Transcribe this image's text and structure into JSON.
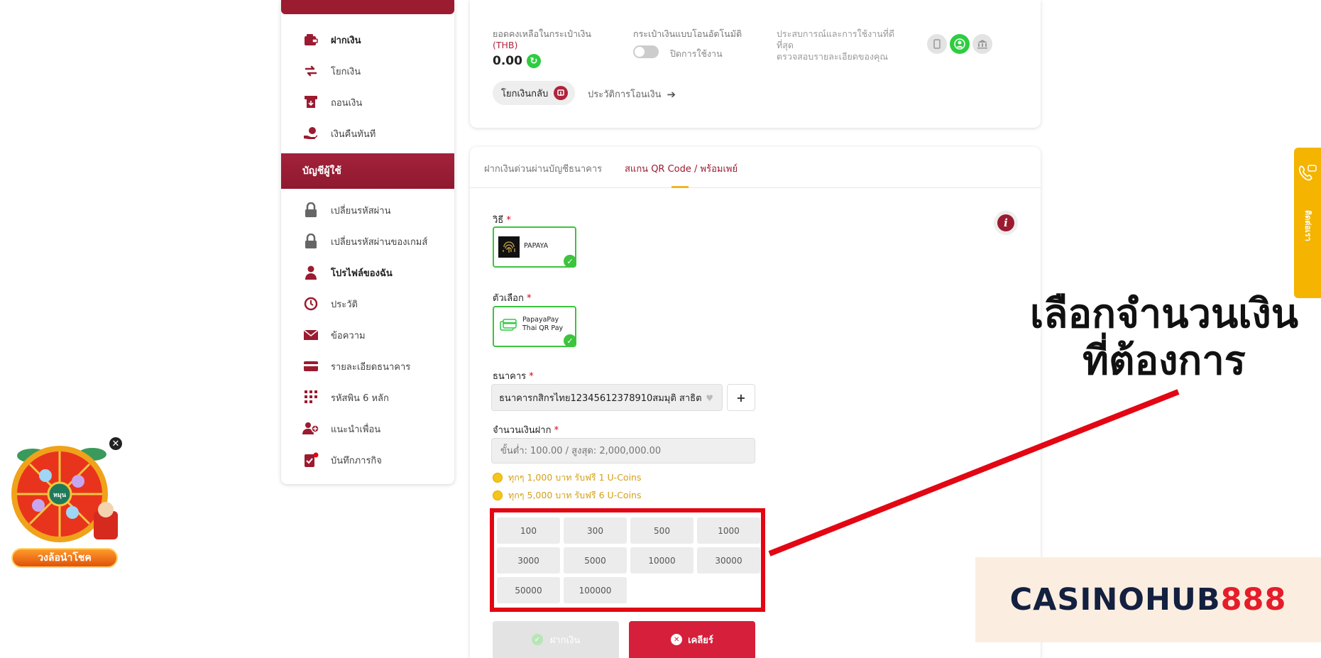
{
  "sidebar": {
    "items_top": [
      {
        "label": "ฝากเงิน",
        "icon": "wallet-icon",
        "bold": true
      },
      {
        "label": "โยกเงิน",
        "icon": "transfer-arrows-icon",
        "bold": false
      },
      {
        "label": "ถอนเงิน",
        "icon": "withdraw-icon",
        "bold": false
      },
      {
        "label": "เงินคืนทันที",
        "icon": "cashback-hand-icon",
        "bold": false
      }
    ],
    "section_title": "บัญชีผู้ใช้",
    "items_account": [
      {
        "label": "เปลี่ยนรหัสผ่าน",
        "icon": "lock-icon",
        "bold": false
      },
      {
        "label": "เปลี่ยนรหัสผ่านของเกมส์",
        "icon": "lock-icon",
        "bold": false
      },
      {
        "label": "โปรไฟล์ของฉัน",
        "icon": "user-icon",
        "bold": true
      },
      {
        "label": "ประวัติ",
        "icon": "history-clock-icon",
        "bold": false
      },
      {
        "label": "ข้อความ",
        "icon": "mail-icon",
        "bold": false
      },
      {
        "label": "รายละเอียดธนาคาร",
        "icon": "bank-card-icon",
        "bold": false
      },
      {
        "label": "รหัสพิน 6 หลัก",
        "icon": "pin-keypad-icon",
        "bold": false
      },
      {
        "label": "แนะนำเพื่อน",
        "icon": "refer-friends-icon",
        "bold": false
      },
      {
        "label": "บันทึกภารกิจ",
        "icon": "mission-log-icon",
        "bold": false
      }
    ]
  },
  "wallet": {
    "balance_label": "ยอดคงเหลือในกระเป๋าเงิน",
    "currency": "(THB)",
    "balance": "0.00",
    "auto_transfer_label": "กระเป๋าเงินแบบโอนอัตโนมัติ",
    "auto_transfer_state": "ปิดการใช้งาน",
    "experience_text": "ประสบการณ์และการใช้งานที่ดีที่สุด",
    "verify_text": "ตรวจสอบรายละเอียดของคุณ",
    "transfer_back_label": "โยกเงินกลับ",
    "transfer_history_label": "ประวัติการโอนเงิน"
  },
  "deposit": {
    "tab_bank": "ฝากเงินด่วนผ่านบัญชีธนาคาร",
    "tab_qr": "สแกน QR Code / พร้อมเพย์",
    "method_label": "วิธี",
    "method_value": "PAPAYA",
    "option_label": "ตัวเลือก",
    "option_line1": "PapayaPay",
    "option_line2": "Thai QR Pay",
    "bank_label": "ธนาคาร",
    "bank_value": "ธนาคารกสิกรไทย12345612378910สมมุติ สาธิต",
    "plus": "+",
    "amount_label": "จำนวนเงินฝาก",
    "amount_placeholder": "ขั้นต่ำ: 100.00 / สูงสุด: 2,000,000.00",
    "promo1": "ทุกๆ 1,000 บาท รับฟรี 1 U-Coins",
    "promo2": "ทุกๆ 5,000 บาท รับฟรี 6 U-Coins",
    "amounts": [
      "100",
      "300",
      "500",
      "1000",
      "3000",
      "5000",
      "10000",
      "30000",
      "50000",
      "100000"
    ],
    "submit_label": "ฝากเงิน",
    "clear_label": "เคลียร์"
  },
  "annotation": {
    "line1": "เลือกจำนวนเงิน",
    "line2": "ที่ต้องการ",
    "color": "#e30613"
  },
  "side_tab": {
    "label": "ติดต่อเรา",
    "icon": "phone-chat-icon",
    "color": "#f4b400"
  },
  "logo": {
    "main": "CASINOHUB",
    "num": "888"
  },
  "lucky_wheel": {
    "center": "หมุน",
    "label": "วงล้อนำโชค"
  },
  "colors": {
    "brand": "#9b1b30",
    "success": "#3cc43c",
    "danger": "#d61f3a"
  }
}
